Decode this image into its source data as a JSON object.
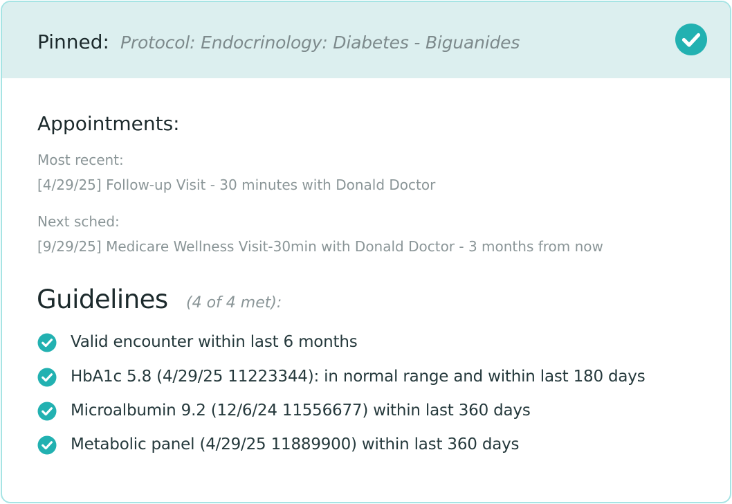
{
  "pinned": {
    "label": "Pinned:",
    "value": "Protocol: Endocrinology: Diabetes - Biguanides",
    "status_icon": "check-circle-icon",
    "accent_color": "#22b1b1",
    "bar_color": "#dcefef"
  },
  "appointments": {
    "heading": "Appointments:",
    "most_recent": {
      "label": "Most recent:",
      "value": "[4/29/25] Follow-up Visit - 30 minutes with Donald Doctor"
    },
    "next_scheduled": {
      "label": "Next sched:",
      "value": "[9/29/25] Medicare Wellness Visit-30min with Donald Doctor - 3 months from now"
    }
  },
  "guidelines": {
    "title": "Guidelines",
    "count": "(4 of 4 met):",
    "items": [
      {
        "text": "Valid encounter within last 6 months",
        "icon": "check-circle-icon"
      },
      {
        "text": "HbA1c 5.8 (4/29/25 11223344): in normal range and within last 180 days",
        "icon": "check-circle-icon"
      },
      {
        "text": "Microalbumin 9.2 (12/6/24 11556677) within last 360 days",
        "icon": "check-circle-icon"
      },
      {
        "text": "Metabolic panel (4/29/25 11889900) within last 360 days",
        "icon": "check-circle-icon"
      }
    ]
  }
}
